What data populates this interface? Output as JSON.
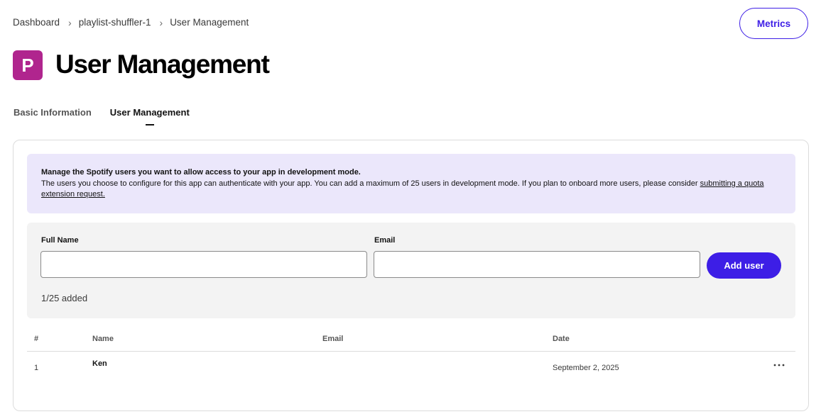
{
  "breadcrumb": {
    "items": [
      "Dashboard",
      "playlist-shuffler-1",
      "User Management"
    ],
    "separator": "›"
  },
  "header": {
    "metrics_label": "Metrics",
    "app_icon_letter": "P",
    "app_icon_color": "#b0258e",
    "title": "User Management"
  },
  "tabs": [
    {
      "label": "Basic Information",
      "active": false
    },
    {
      "label": "User Management",
      "active": true
    }
  ],
  "notice": {
    "title": "Manage the Spotify users you want to allow access to your app in development mode.",
    "body": "The users you choose to configure for this app can authenticate with your app. You can add a maximum of 25 users in development mode. If you plan to onboard more users, please consider ",
    "link": "submitting a quota extension request."
  },
  "form": {
    "full_name_label": "Full Name",
    "full_name_value": "",
    "email_label": "Email",
    "email_value": "",
    "add_button": "Add user",
    "count_text": "1/25 added"
  },
  "table": {
    "headers": {
      "num": "#",
      "name": "Name",
      "email": "Email",
      "date": "Date"
    },
    "rows": [
      {
        "num": "1",
        "name": "Ken",
        "email": "",
        "date": "September 2, 2025"
      }
    ],
    "row_menu_icon": "more-horizontal-icon"
  },
  "colors": {
    "accent": "#3d1ee6",
    "notice_bg": "#ebe7fb",
    "panel_bg": "#f3f3f3"
  }
}
